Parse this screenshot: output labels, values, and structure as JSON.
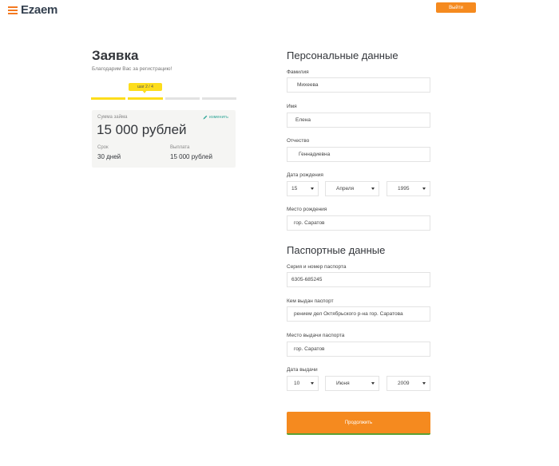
{
  "header": {
    "logo_text": "Ezaem",
    "logout_label": "Выйти"
  },
  "application": {
    "title": "Заявка",
    "subtitle": "Благодарим Вас за регистрацию!",
    "step_label": "шаг 2 / 4",
    "progress": {
      "current_step": 2,
      "total_steps": 4
    }
  },
  "loan_card": {
    "amount_label": "Сумма займа",
    "edit_label": "изменить",
    "amount": "15 000 рублей",
    "term_label": "Срок",
    "term_value": "30 дней",
    "payout_label": "Выплата",
    "payout_value": "15 000 рублей"
  },
  "personal": {
    "heading": "Персональные данные",
    "last_name_label": "Фамилия",
    "last_name": "Михеева",
    "first_name_label": "Имя",
    "first_name": "Елена",
    "patronymic_label": "Отчество",
    "patronymic": "Геннадиевна",
    "birth_date_label": "Дата рождения",
    "birth_day": "15",
    "birth_month": "Апреля",
    "birth_year": "1995",
    "birth_place_label": "Место рождения",
    "birth_place": "гор. Саратов"
  },
  "passport": {
    "heading": "Паспортные данные",
    "number_label": "Серия и номер паспорта",
    "number": "6305-685245",
    "issued_by_label": "Кем выдан паспорт",
    "issued_by": "рением дел Октябрьского р-на гор. Саратова",
    "issue_place_label": "Место выдачи паспорта",
    "issue_place": "гор. Саратов",
    "issue_date_label": "Дата выдачи",
    "issue_day": "10",
    "issue_month": "Июня",
    "issue_year": "2009"
  },
  "actions": {
    "continue_label": "Продолжить"
  },
  "colors": {
    "accent_orange": "#f58a1f",
    "step_yellow": "#fddd1b",
    "edit_teal": "#35a89a",
    "button_underline_green": "#5ba032"
  }
}
